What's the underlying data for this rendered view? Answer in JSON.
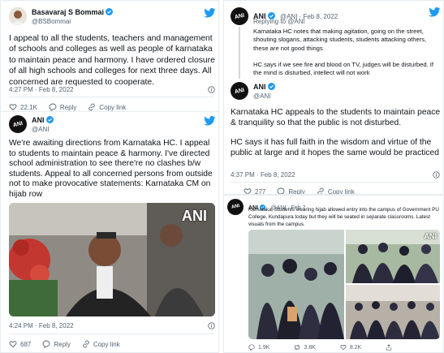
{
  "colors": {
    "twitter_blue": "#1d9bf0",
    "text": "#0f1419",
    "muted": "#536471",
    "verified": "#1d9bf0"
  },
  "tweet1": {
    "name": "Basavaraj S Bommai",
    "handle": "@BSBommai",
    "text": "I appeal to all the students,  teachers and management of schools and colleges as well as people of karnataka to maintain peace and harmony. I have ordered closure of all high schools and colleges for next three days. All concerned are requested to cooperate.",
    "time": "4:27 PM · Feb 8, 2022",
    "likes": "22.1K",
    "reply_label": "Reply",
    "copy_label": "Copy link"
  },
  "tweet2": {
    "name": "ANI",
    "handle": "@ANI",
    "text": "We're awaiting directions from Karnataka HC. I appeal to students to maintain peace & harmony. I've directed school administration to see there're no clashes b/w students. Appeal to all concerned persons from outside not to make provocative statements: Karnataka CM on hijab row",
    "watermark": "ANI",
    "time": "4:24 PM · Feb 8, 2022",
    "likes": "687",
    "reply_label": "Reply",
    "copy_label": "Copy link"
  },
  "tweet3": {
    "parent": {
      "name": "ANI",
      "handle_date": "@ANI · Feb 8, 2022",
      "replying": "Replying to @ANI",
      "text1": "Karnataka HC notes that making agitation, going on the street, shouting slogans, attacking students, students attacking others, these are not good things",
      "text2": "HC says if we see fire and blood on TV, judges will be disturbed. If the mind is disturbed, intellect will not work"
    },
    "name": "ANI",
    "handle": "@ANI",
    "text1": "Karnataka HC appeals to the students to maintain peace & tranquility so that the public is not disturbed.",
    "text2": "HC says it has full faith in the wisdom and virtue of the public at large and it hopes the same would be practiced",
    "time": "4:37 PM · Feb 8, 2022",
    "likes": "277",
    "reply_label": "Reply",
    "copy_label": "Copy link"
  },
  "tweet4": {
    "name": "ANI",
    "handle_date": "@ANI · Feb 7",
    "text": "Karnataka: Students wearing hijab allowed entry into the campus of Government PU College, Kundapura today but they will be seated in separate classrooms. Latest visuals from the campus.",
    "watermark": "ANI",
    "replies": "1.9K",
    "retweets": "3.8K",
    "likes": "8.2K"
  },
  "avatar_text": "ANI"
}
